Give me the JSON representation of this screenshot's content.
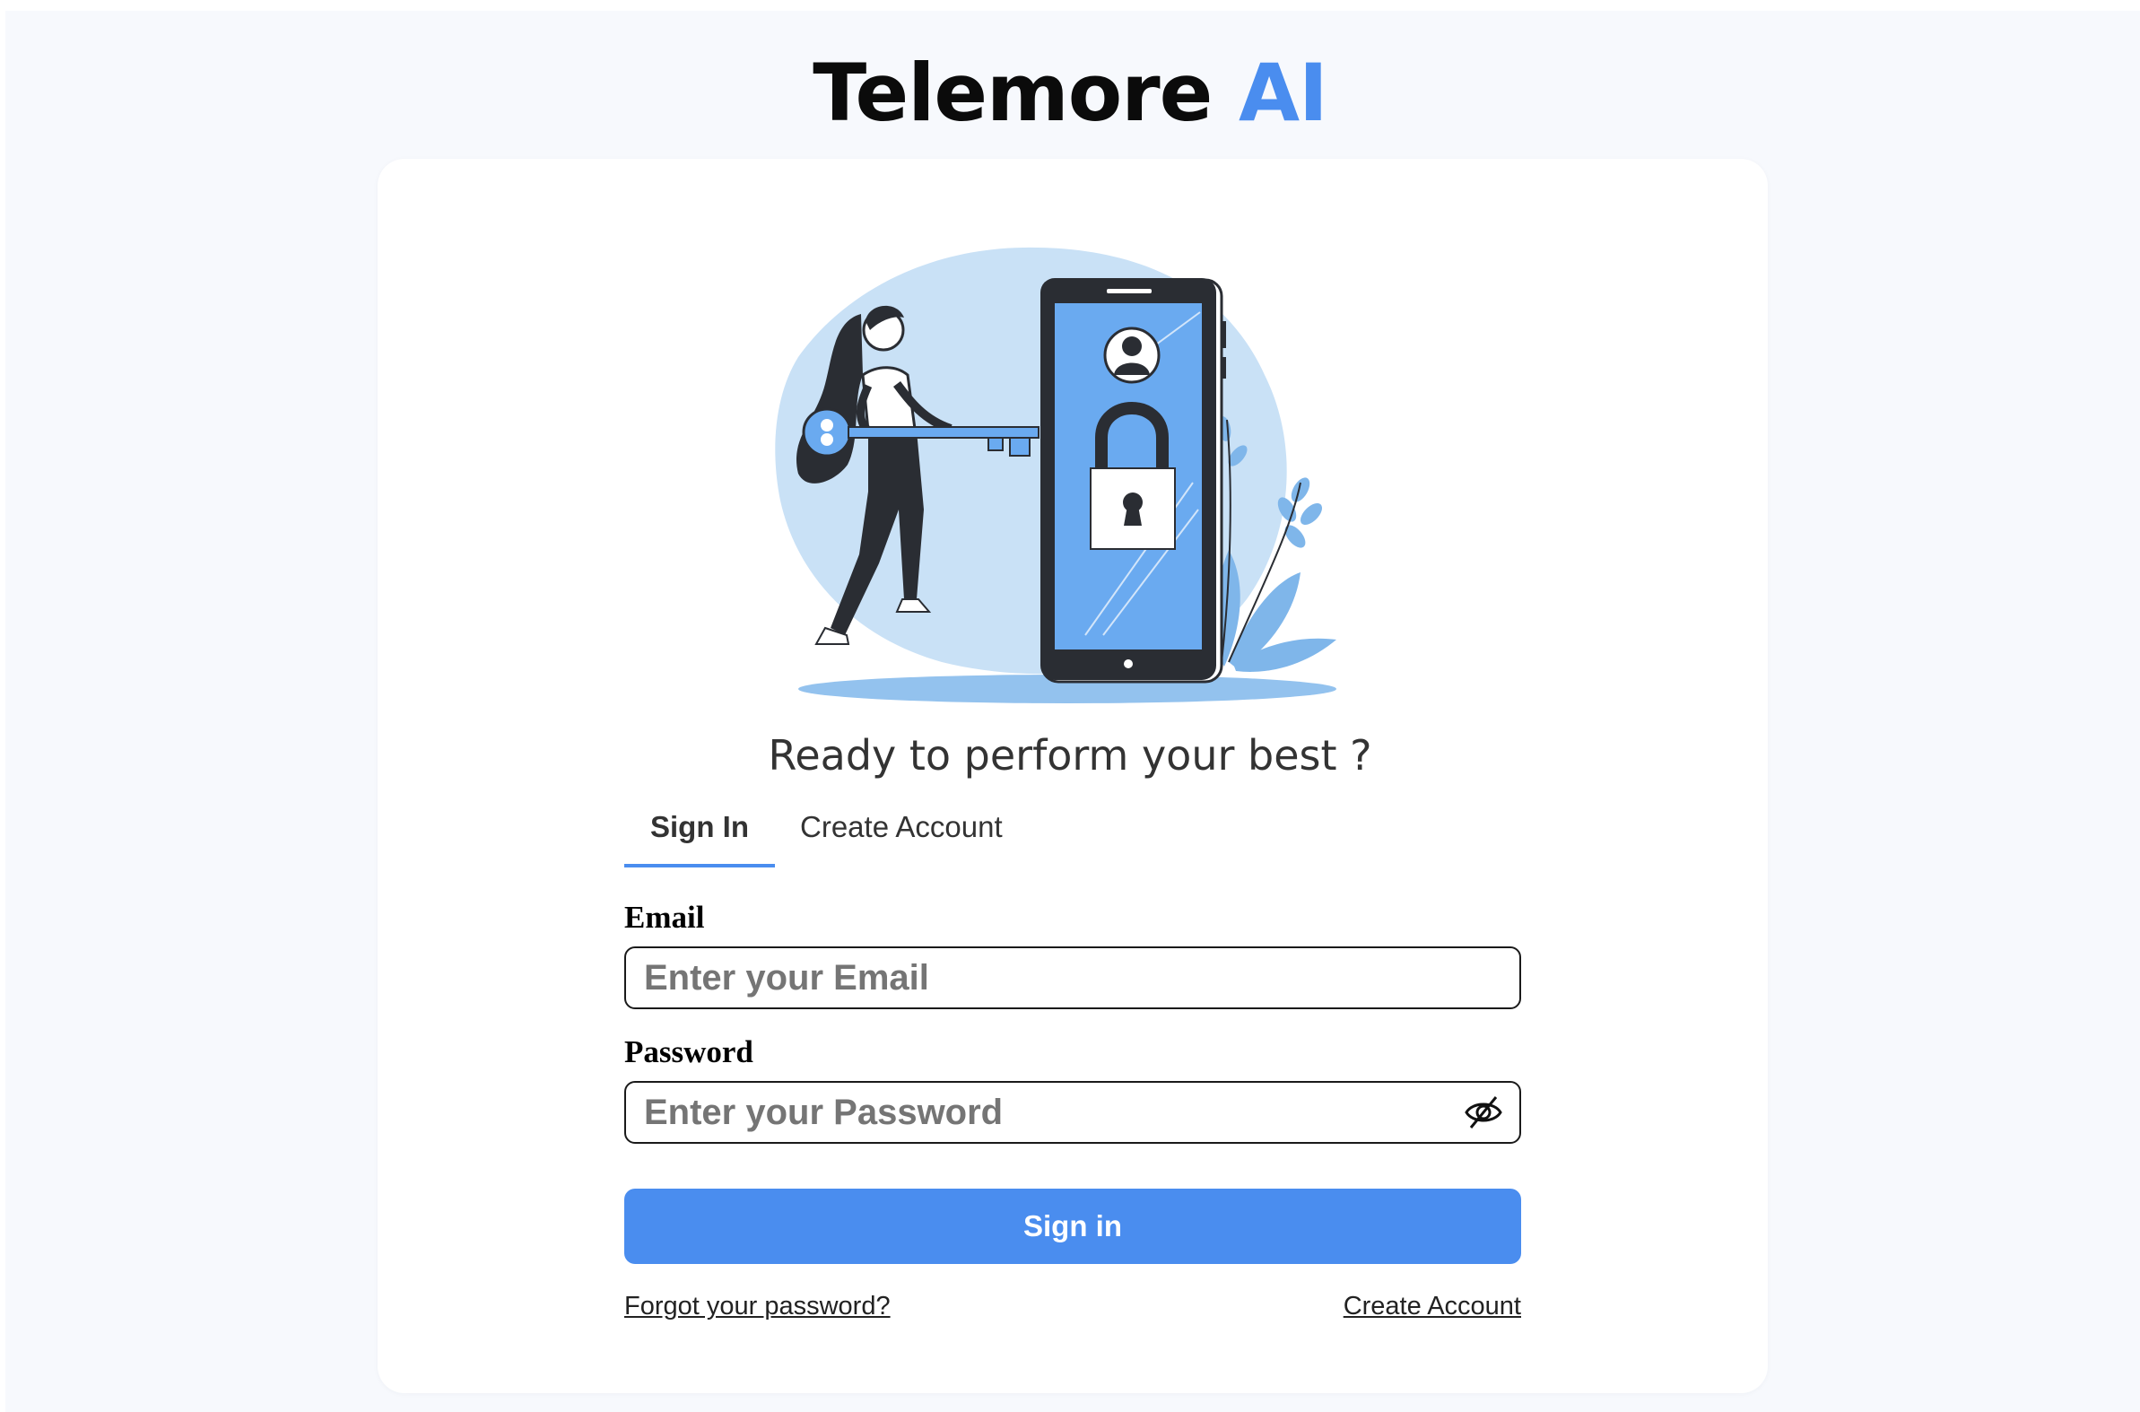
{
  "brand": {
    "name": "Telemore",
    "accent": "AI",
    "accent_color": "#4a8def"
  },
  "illustration": {
    "icon": "phone-lock-key-illustration"
  },
  "headline": "Ready to perform your best ?",
  "tabs": {
    "active": "Sign In",
    "items": [
      {
        "label": "Sign In",
        "active": true
      },
      {
        "label": "Create Account",
        "active": false
      }
    ]
  },
  "form": {
    "email": {
      "label": "Email",
      "placeholder": "Enter your Email",
      "value": ""
    },
    "password": {
      "label": "Password",
      "placeholder": "Enter your Password",
      "value": "",
      "toggle_icon": "eye-slash-icon"
    },
    "submit_label": "Sign in"
  },
  "links": {
    "forgot_password": "Forgot your password?",
    "create_account": "Create Account"
  },
  "colors": {
    "primary": "#4a8def",
    "page_background": "#f7f9fd",
    "card_background": "#ffffff",
    "text": "#333333"
  }
}
